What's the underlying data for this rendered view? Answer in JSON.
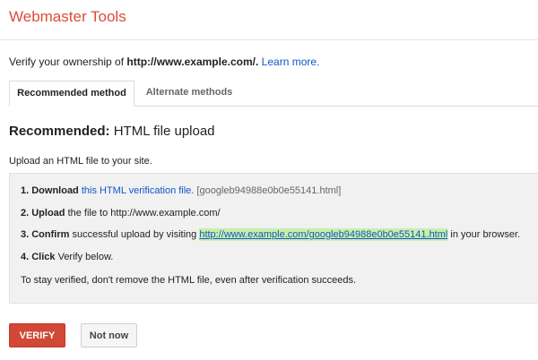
{
  "header": {
    "title": "Webmaster Tools"
  },
  "intro": {
    "prefix": "Verify your ownership of ",
    "site": "http://www.example.com/.",
    "learn_more": "Learn more."
  },
  "tabs": [
    {
      "label": "Recommended method",
      "active": true
    },
    {
      "label": "Alternate methods",
      "active": false
    }
  ],
  "recommended": {
    "label": "Recommended:",
    "method": " HTML file upload",
    "instruction": "Upload an HTML file to your site."
  },
  "steps": {
    "s1_bold": "1. Download",
    "s1_link": "this HTML verification file.",
    "s1_file": " [googleb94988e0b0e55141.html]",
    "s2_bold": "2. Upload",
    "s2_text": " the file to http://www.example.com/",
    "s3_bold": "3. Confirm",
    "s3_text": " successful upload by visiting ",
    "s3_link": "http://www.example.com/googleb94988e0b0e55141.html",
    "s3_suffix": " in your browser.",
    "s4_bold": "4. Click",
    "s4_text": " Verify below.",
    "note": "To stay verified, don't remove the HTML file, even after verification succeeds."
  },
  "buttons": {
    "verify": "VERIFY",
    "not_now": "Not now"
  },
  "colors": {
    "brand": "#dd4b39",
    "verify_button": "#d14836",
    "link": "#1155cc",
    "highlight": "#c8f0a8"
  }
}
